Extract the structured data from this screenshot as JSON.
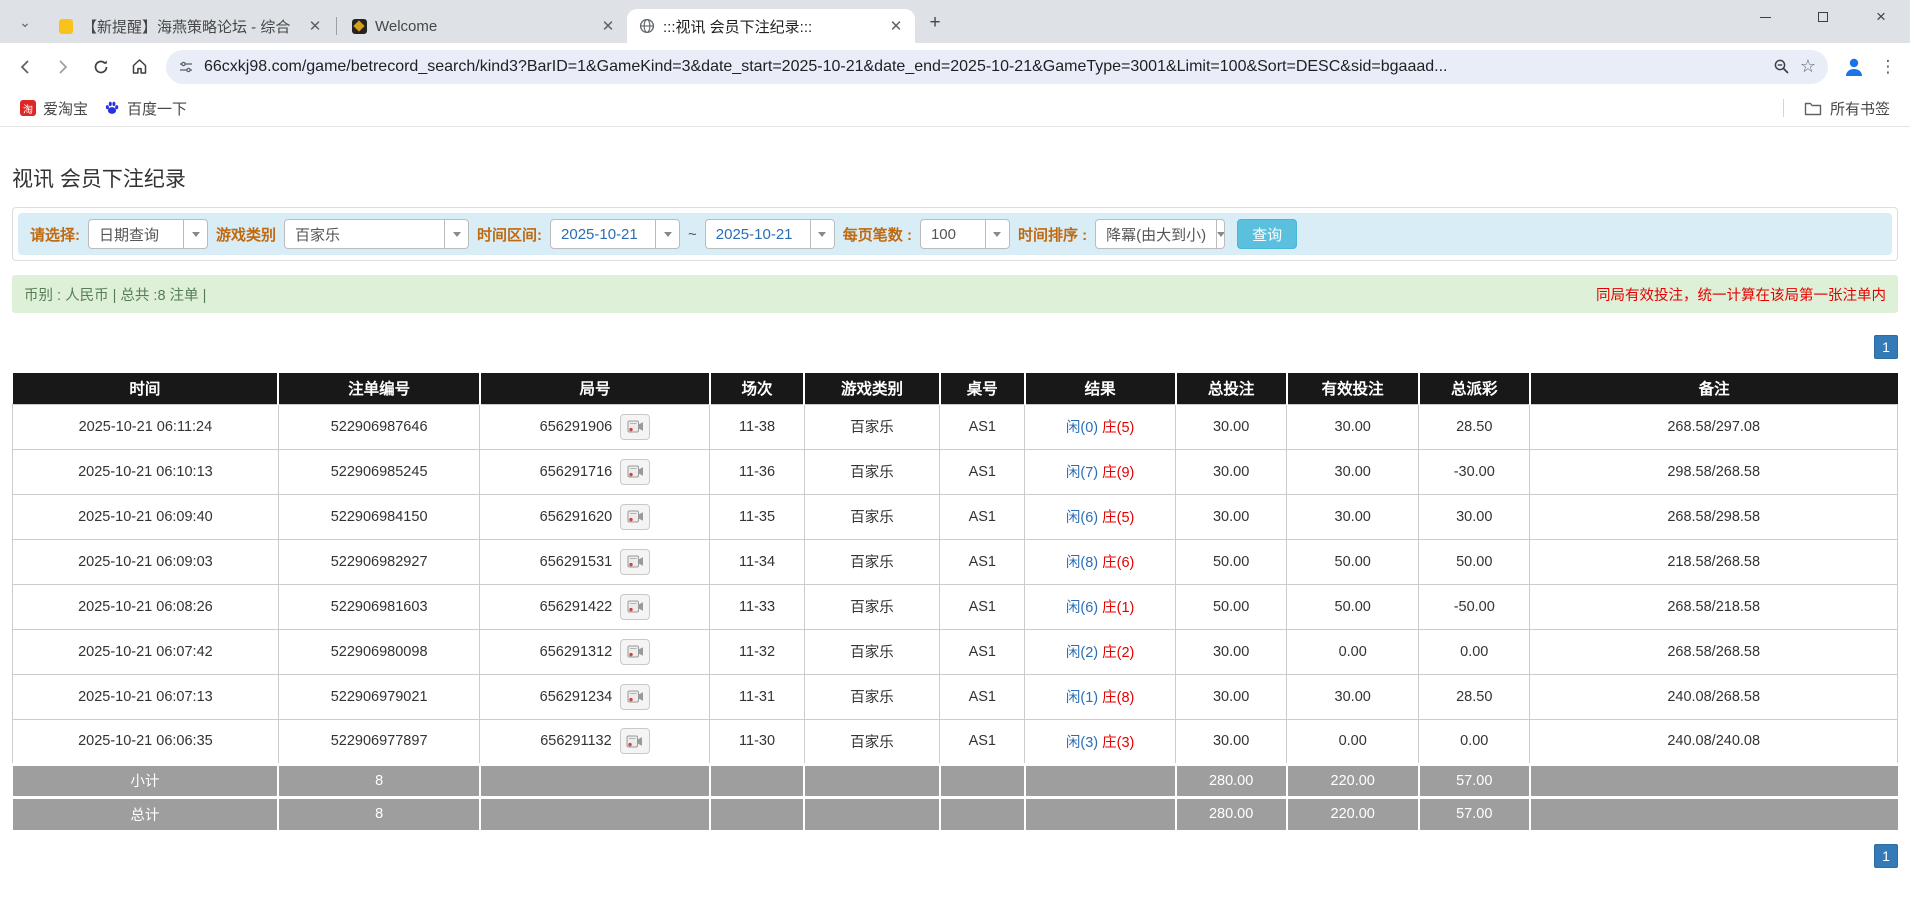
{
  "colors": {
    "accent_blue": "#337ab7",
    "link_blue": "#2a6db5",
    "alert_red": "#e60000",
    "filter_bg": "#d9edf7",
    "summary_bg": "#dff0d8",
    "label_orange": "#c06a10",
    "header_bg": "#181818",
    "subtotal_bg": "#9e9e9e",
    "button_bg": "#5bc0de"
  },
  "browser": {
    "tabs": [
      {
        "label": "【新提醒】海燕策略论坛 - 综合",
        "icon": "yellow-note"
      },
      {
        "label": "Welcome",
        "icon": "dark-crest"
      },
      {
        "label": ":::视讯 会员下注纪录:::",
        "icon": "globe"
      }
    ],
    "url": "66cxkj98.com/game/betrecord_search/kind3?BarID=1&GameKind=3&date_start=2025-10-21&date_end=2025-10-21&GameType=3001&Limit=100&Sort=DESC&sid=bgaaad...",
    "bookmarks": [
      {
        "label": "爱淘宝",
        "icon_text": "淘"
      },
      {
        "label": "百度一下"
      }
    ],
    "all_bookmarks_label": "所有书签",
    "icons": {
      "menu_dots": "⋮",
      "star": "☆",
      "new_tab": "+",
      "tab_close": "✕",
      "window_close": "×",
      "tab_search_chevron": "⌄"
    }
  },
  "page": {
    "title": "视讯 会员下注纪录",
    "filters": {
      "select_label": "请选择:",
      "select_value": "日期查询",
      "game_label": "游戏类别",
      "game_value": "百家乐",
      "range_label": "时间区间:",
      "date_start": "2025-10-21",
      "range_separator": "~",
      "date_end": "2025-10-21",
      "per_page_label": "每页笔数 :",
      "per_page_value": "100",
      "sort_label": "时间排序 :",
      "sort_value": "降冪(由大到小)",
      "search_label": "查询"
    },
    "summary": {
      "left": "币别 : 人民币 | 总共 :8 注单 |",
      "right": "同局有效投注，统一计算在该局第一张注单内"
    },
    "pagination": "1",
    "table": {
      "headers": [
        "时间",
        "注单编号",
        "局号",
        "场次",
        "游戏类别",
        "桌号",
        "结果",
        "总投注",
        "有效投注",
        "总派彩",
        "备注"
      ],
      "rows": [
        {
          "time": "2025-10-21 06:11:24",
          "bet_id": "522906987646",
          "round_id": "656291906",
          "session": "11-38",
          "game": "百家乐",
          "table_no": "AS1",
          "result_player": "闲(0)",
          "result_banker": "庄(5)",
          "total_bet": "30.00",
          "valid_bet": "30.00",
          "payout": "28.50",
          "remark": "268.58/297.08"
        },
        {
          "time": "2025-10-21 06:10:13",
          "bet_id": "522906985245",
          "round_id": "656291716",
          "session": "11-36",
          "game": "百家乐",
          "table_no": "AS1",
          "result_player": "闲(7)",
          "result_banker": "庄(9)",
          "total_bet": "30.00",
          "valid_bet": "30.00",
          "payout": "-30.00",
          "remark": "298.58/268.58"
        },
        {
          "time": "2025-10-21 06:09:40",
          "bet_id": "522906984150",
          "round_id": "656291620",
          "session": "11-35",
          "game": "百家乐",
          "table_no": "AS1",
          "result_player": "闲(6)",
          "result_banker": "庄(5)",
          "total_bet": "30.00",
          "valid_bet": "30.00",
          "payout": "30.00",
          "remark": "268.58/298.58"
        },
        {
          "time": "2025-10-21 06:09:03",
          "bet_id": "522906982927",
          "round_id": "656291531",
          "session": "11-34",
          "game": "百家乐",
          "table_no": "AS1",
          "result_player": "闲(8)",
          "result_banker": "庄(6)",
          "total_bet": "50.00",
          "valid_bet": "50.00",
          "payout": "50.00",
          "remark": "218.58/268.58"
        },
        {
          "time": "2025-10-21 06:08:26",
          "bet_id": "522906981603",
          "round_id": "656291422",
          "session": "11-33",
          "game": "百家乐",
          "table_no": "AS1",
          "result_player": "闲(6)",
          "result_banker": "庄(1)",
          "total_bet": "50.00",
          "valid_bet": "50.00",
          "payout": "-50.00",
          "remark": "268.58/218.58"
        },
        {
          "time": "2025-10-21 06:07:42",
          "bet_id": "522906980098",
          "round_id": "656291312",
          "session": "11-32",
          "game": "百家乐",
          "table_no": "AS1",
          "result_player": "闲(2)",
          "result_banker": "庄(2)",
          "total_bet": "30.00",
          "valid_bet": "0.00",
          "payout": "0.00",
          "remark": "268.58/268.58"
        },
        {
          "time": "2025-10-21 06:07:13",
          "bet_id": "522906979021",
          "round_id": "656291234",
          "session": "11-31",
          "game": "百家乐",
          "table_no": "AS1",
          "result_player": "闲(1)",
          "result_banker": "庄(8)",
          "total_bet": "30.00",
          "valid_bet": "30.00",
          "payout": "28.50",
          "remark": "240.08/268.58"
        },
        {
          "time": "2025-10-21 06:06:35",
          "bet_id": "522906977897",
          "round_id": "656291132",
          "session": "11-30",
          "game": "百家乐",
          "table_no": "AS1",
          "result_player": "闲(3)",
          "result_banker": "庄(3)",
          "total_bet": "30.00",
          "valid_bet": "0.00",
          "payout": "0.00",
          "remark": "240.08/240.08"
        }
      ],
      "subtotal": {
        "label": "小计",
        "count": "8",
        "total_bet": "280.00",
        "valid_bet": "220.00",
        "payout": "57.00"
      },
      "total": {
        "label": "总计",
        "count": "8",
        "total_bet": "280.00",
        "valid_bet": "220.00",
        "payout": "57.00"
      }
    }
  }
}
